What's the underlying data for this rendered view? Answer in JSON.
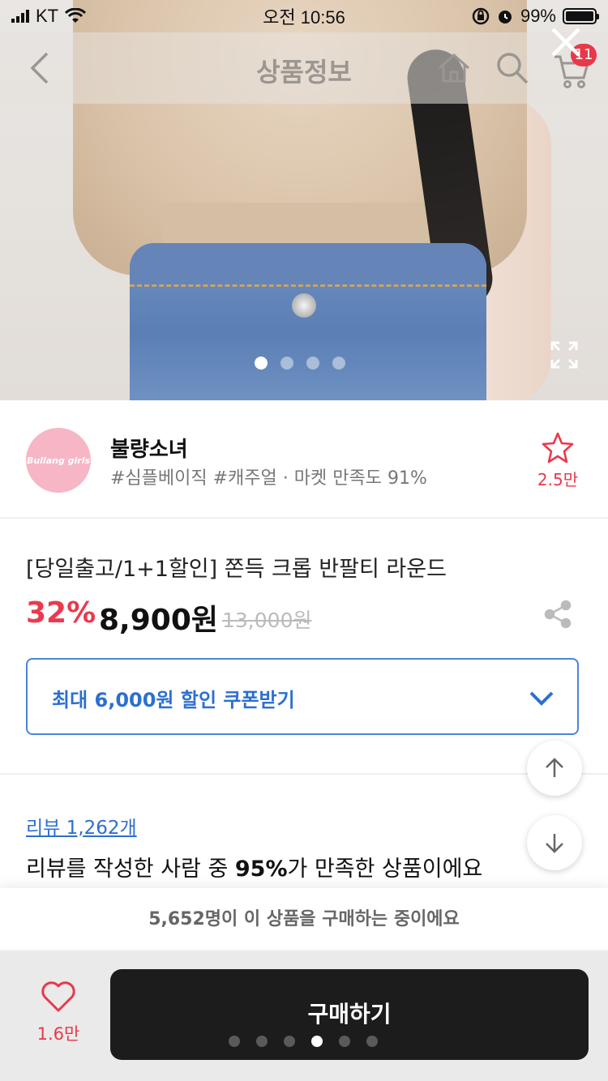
{
  "status": {
    "carrier": "KT",
    "time": "오전 10:56",
    "battery": "99%",
    "battery_level": 0.99
  },
  "nav": {
    "title": "상품정보",
    "cart_count": "11"
  },
  "hero": {
    "slide_count": 4,
    "active_slide": 1
  },
  "shop": {
    "logo_text": "Bullang girls",
    "name": "불량소녀",
    "tags": "#심플베이직 #캐주얼 · 마켓 만족도 91%",
    "favorites": "2.5만"
  },
  "product": {
    "title": "[당일출고/1+1할인] 쫀득 크롭 반팔티 라운드",
    "discount": "32%",
    "price": "8,900원",
    "original_price": "13,000원"
  },
  "coupon": {
    "label": "최대 6,000원 할인 쿠폰받기"
  },
  "review": {
    "link": "리뷰 1,262개",
    "summary_pre": "리뷰를 작성한 사람 중 ",
    "summary_bold": "95%",
    "summary_post": "가 만족한 상품이에요"
  },
  "bottom": {
    "buying_now": "5,652명이 이 상품을 구매하는 중이에요",
    "likes": "1.6만",
    "buy_label": "구매하기",
    "page_dot_count": 6,
    "active_page_dot": 4
  },
  "colors": {
    "accent_red": "#e8394b",
    "accent_blue": "#2c6fd1",
    "buy_button": "#1c1c1c"
  }
}
